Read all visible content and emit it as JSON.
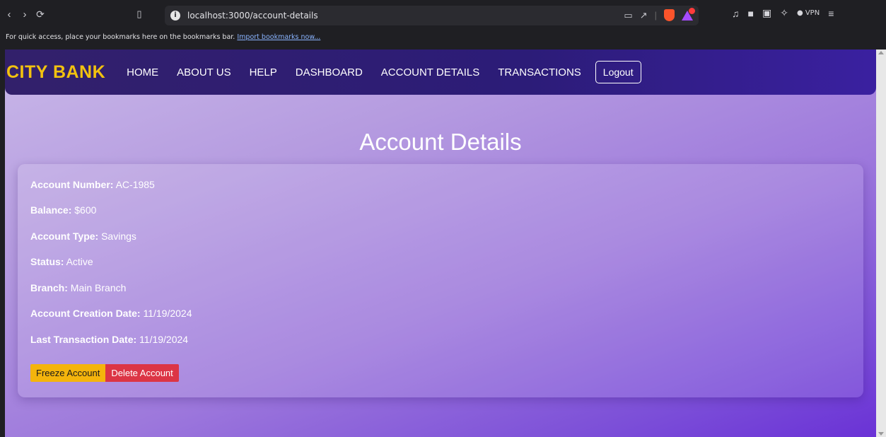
{
  "browser": {
    "back_icon": "chevron-left-icon",
    "forward_icon": "chevron-right-icon",
    "reload_icon": "reload-icon",
    "url": "localhost:3000/account-details",
    "bookmarks_text": "For quick access, place your bookmarks here on the bookmarks bar.",
    "bookmarks_link": "Import bookmarks now...",
    "vpn_label": "VPN"
  },
  "navbar": {
    "brand": "CITY BANK",
    "links": [
      "HOME",
      "ABOUT US",
      "HELP",
      "DASHBOARD",
      "ACCOUNT DETAILS",
      "TRANSACTIONS"
    ],
    "logout": "Logout"
  },
  "page": {
    "title": "Account Details",
    "fields": [
      {
        "label": "Account Number:",
        "value": "AC-1985"
      },
      {
        "label": "Balance:",
        "value": "$600"
      },
      {
        "label": "Account Type:",
        "value": "Savings"
      },
      {
        "label": "Status:",
        "value": "Active"
      },
      {
        "label": "Branch:",
        "value": "Main Branch"
      },
      {
        "label": "Account Creation Date:",
        "value": "11/19/2024"
      },
      {
        "label": "Last Transaction Date:",
        "value": "11/19/2024"
      }
    ],
    "freeze_button": "Freeze Account",
    "delete_button": "Delete Account"
  },
  "colors": {
    "brand": "#f2c20f",
    "freeze": "#f4b40c",
    "delete": "#dc3545"
  }
}
